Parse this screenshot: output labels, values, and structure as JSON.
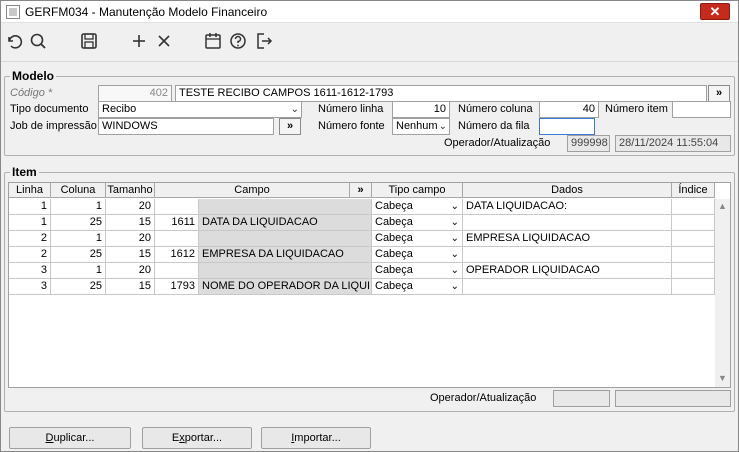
{
  "window": {
    "title": "GERFM034 - Manutenção Modelo Financeiro",
    "close_glyph": "✕"
  },
  "toolbar": {
    "icons": [
      "undo-icon",
      "search-icon",
      "save-icon",
      "add-icon",
      "delete-icon",
      "calendar-icon",
      "help-icon",
      "exit-icon"
    ]
  },
  "modelo": {
    "group_title": "Modelo",
    "codigo_label": "Código *",
    "codigo_value": "402",
    "descricao_value": "TESTE RECIBO CAMPOS 1611-1612-1793",
    "descricao_btn": "»",
    "tipo_documento_label": "Tipo documento",
    "tipo_documento_value": "Recibo",
    "numero_linha_label": "Número linha",
    "numero_linha_value": "10",
    "numero_coluna_label": "Número coluna",
    "numero_coluna_value": "40",
    "numero_item_label": "Número item",
    "numero_item_value": "",
    "job_label": "Job de impressão",
    "job_value": "WINDOWS",
    "job_btn": "»",
    "numero_fonte_label": "Número fonte",
    "numero_fonte_value": "Nenhum",
    "numero_fila_label": "Número da fila",
    "numero_fila_value": "",
    "operador_label": "Operador/Atualização",
    "operador_value": "999998",
    "atualizacao_value": "28/11/2024 11:55:04"
  },
  "item": {
    "group_title": "Item",
    "columns": {
      "linha": "Linha",
      "coluna": "Coluna",
      "tamanho": "Tamanho",
      "campo": "Campo",
      "campo_btn": "»",
      "tipo_campo": "Tipo campo",
      "dados": "Dados",
      "indice": "Índice"
    },
    "rows": [
      {
        "linha": "1",
        "coluna": "1",
        "tamanho": "20",
        "campo_code": "",
        "campo_desc": "",
        "tipo": "Cabeça",
        "dados": "DATA LIQUIDACAO:",
        "indice": ""
      },
      {
        "linha": "1",
        "coluna": "25",
        "tamanho": "15",
        "campo_code": "1611",
        "campo_desc": "DATA DA LIQUIDACAO",
        "tipo": "Cabeça",
        "dados": "",
        "indice": ""
      },
      {
        "linha": "2",
        "coluna": "1",
        "tamanho": "20",
        "campo_code": "",
        "campo_desc": "",
        "tipo": "Cabeça",
        "dados": "EMPRESA LIQUIDACAO",
        "indice": ""
      },
      {
        "linha": "2",
        "coluna": "25",
        "tamanho": "15",
        "campo_code": "1612",
        "campo_desc": "EMPRESA DA LIQUIDACAO",
        "tipo": "Cabeça",
        "dados": "",
        "indice": ""
      },
      {
        "linha": "3",
        "coluna": "1",
        "tamanho": "20",
        "campo_code": "",
        "campo_desc": "",
        "tipo": "Cabeça",
        "dados": "OPERADOR LIQUIDACAO",
        "indice": ""
      },
      {
        "linha": "3",
        "coluna": "25",
        "tamanho": "15",
        "campo_code": "1793",
        "campo_desc": "NOME DO OPERADOR DA LIQUIDAÇÃO",
        "tipo": "Cabeça",
        "dados": "",
        "indice": ""
      }
    ],
    "operador_label": "Operador/Atualização",
    "operador_value": "",
    "atualizacao_value": ""
  },
  "buttons": {
    "duplicar_key": "D",
    "duplicar_rest": "uplicar...",
    "exportar_pre": "E",
    "exportar_key": "x",
    "exportar_rest": "portar...",
    "importar_key": "I",
    "importar_rest": "mportar..."
  }
}
